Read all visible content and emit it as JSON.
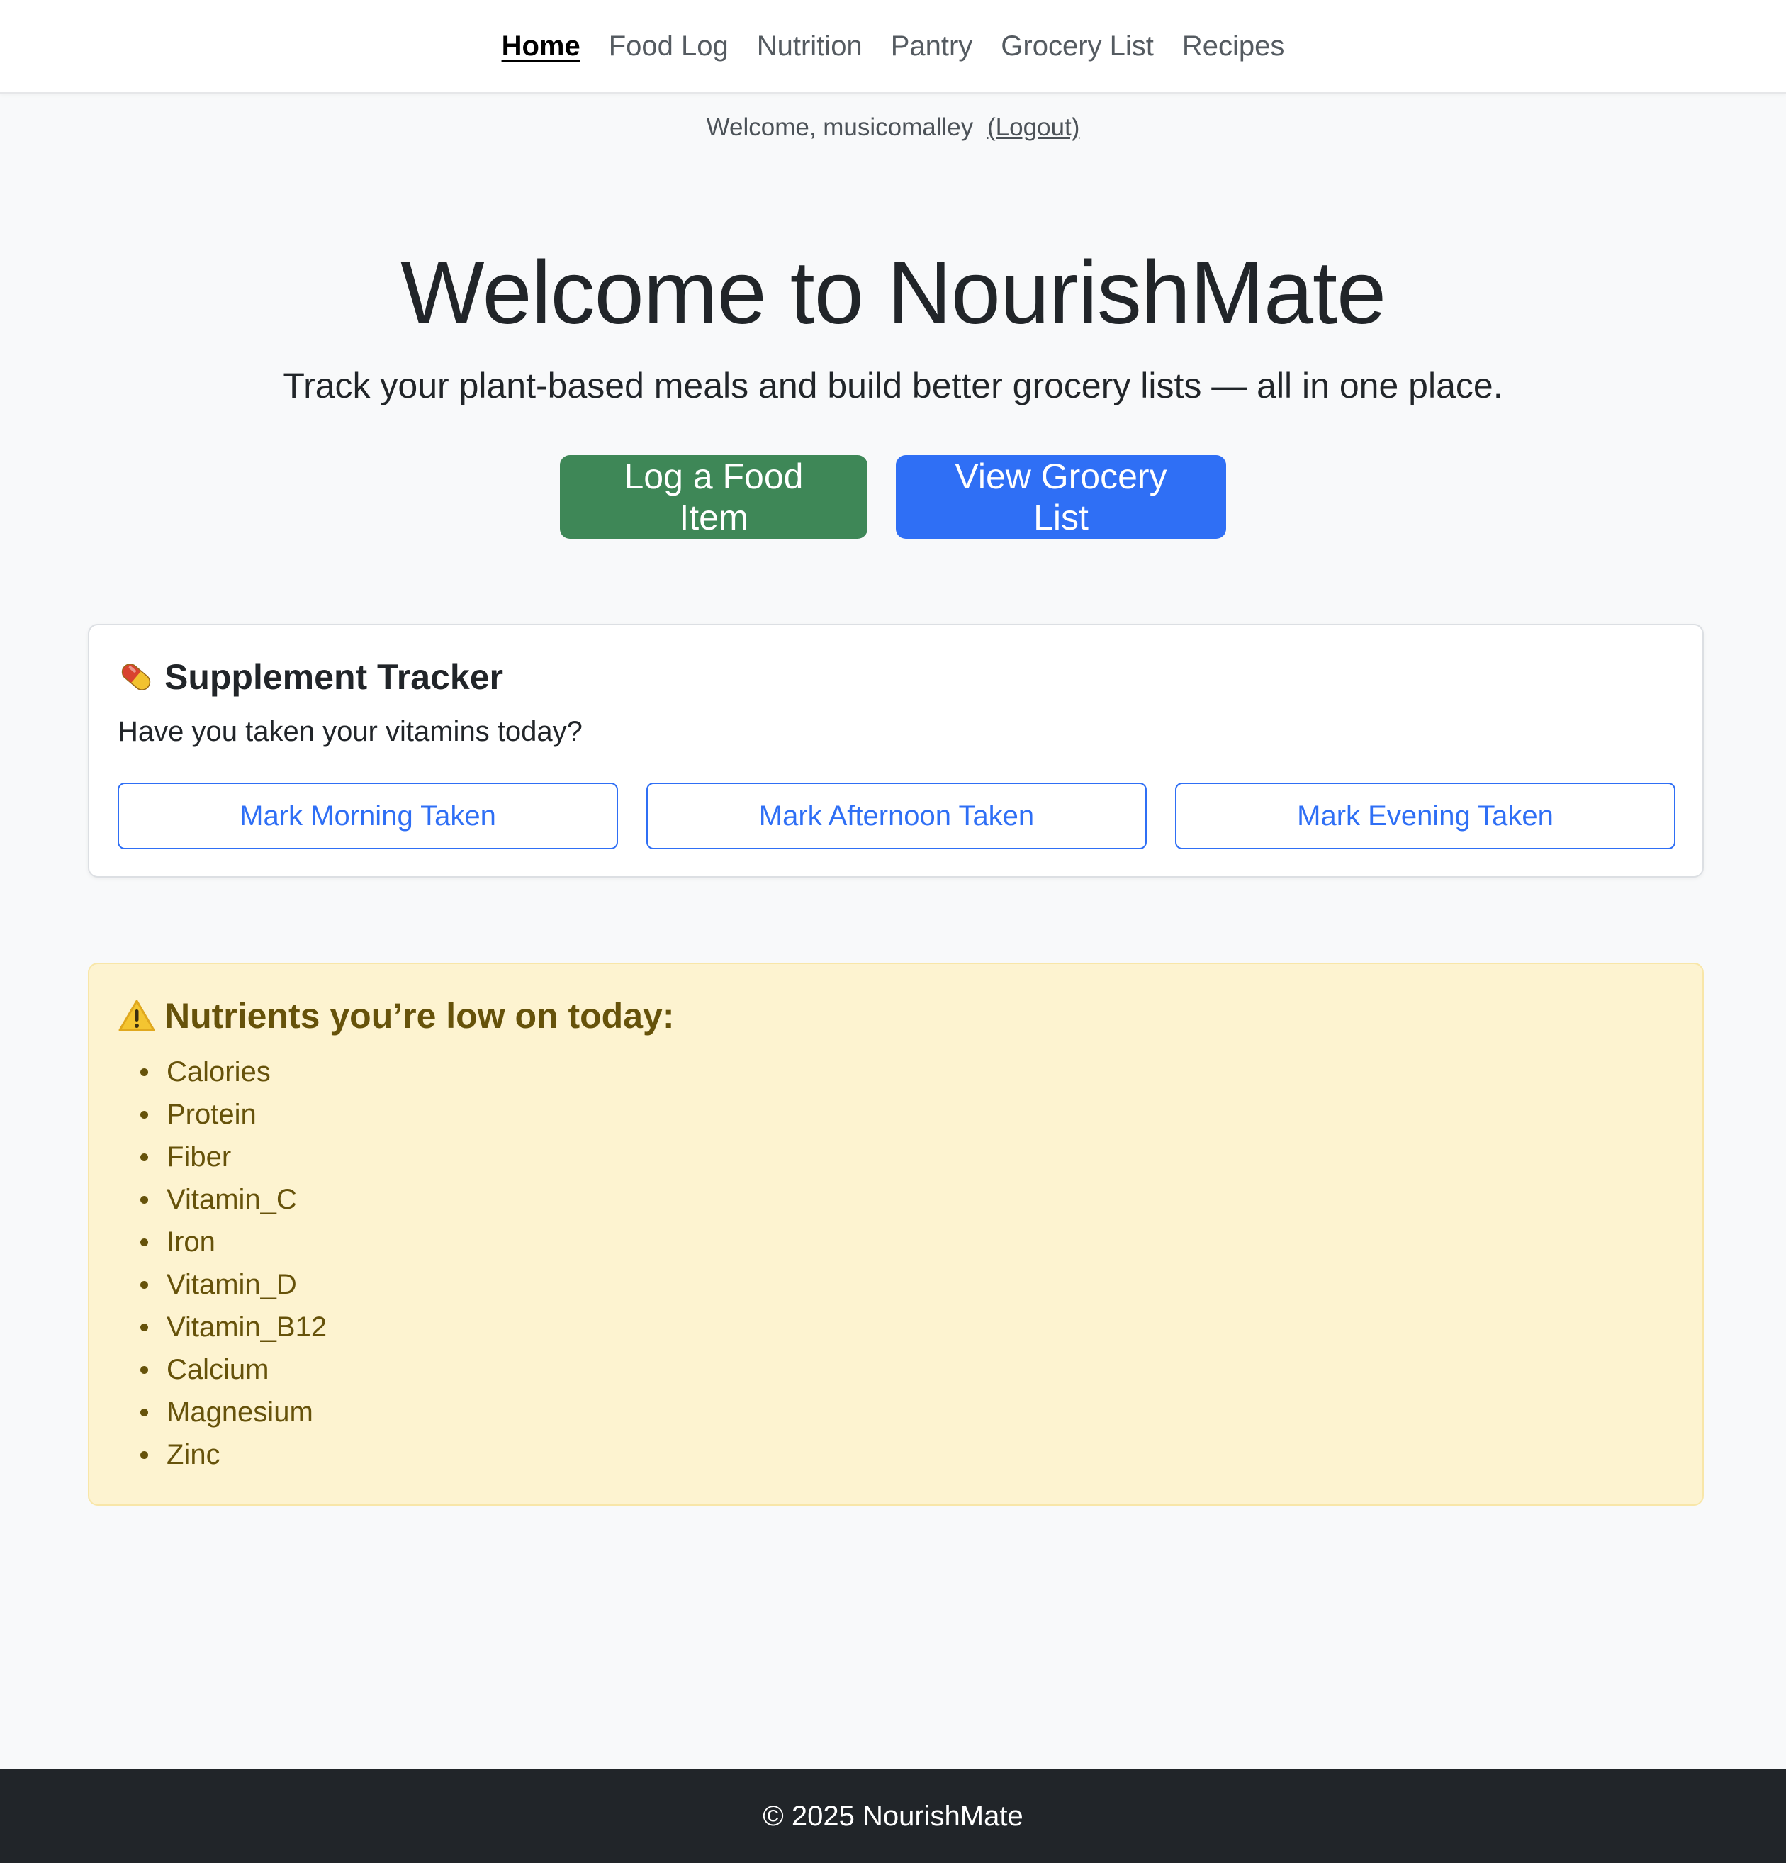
{
  "nav": {
    "items": [
      {
        "label": "Home",
        "active": true
      },
      {
        "label": "Food Log"
      },
      {
        "label": "Nutrition"
      },
      {
        "label": "Pantry"
      },
      {
        "label": "Grocery List"
      },
      {
        "label": "Recipes"
      }
    ]
  },
  "session": {
    "welcome_text": "Welcome, musicomalley",
    "logout_label": "(Logout)"
  },
  "hero": {
    "title": "Welcome to NourishMate",
    "subtitle": "Track your plant-based meals and build better grocery lists — all in one place.",
    "log_button_label": "Log a Food Item",
    "grocery_button_label": "View Grocery List"
  },
  "supplements": {
    "icon": "pill-icon",
    "title": "Supplement Tracker",
    "question": "Have you taken your vitamins today?",
    "buttons": [
      {
        "label": "Mark Morning Taken"
      },
      {
        "label": "Mark Afternoon Taken"
      },
      {
        "label": "Mark Evening Taken"
      }
    ]
  },
  "low_nutrients": {
    "icon": "warning-icon",
    "title": "Nutrients you’re low on today:",
    "items": [
      "Calories",
      "Protein",
      "Fiber",
      "Vitamin_C",
      "Iron",
      "Vitamin_D",
      "Vitamin_B12",
      "Calcium",
      "Magnesium",
      "Zinc"
    ]
  },
  "footer": {
    "text": "© 2025 NourishMate"
  },
  "colors": {
    "primary_green": "#3e8757",
    "primary_blue": "#2f6ff5",
    "warning_bg": "#fdf3d0",
    "warning_text": "#66520a",
    "footer_bg": "#212529"
  }
}
